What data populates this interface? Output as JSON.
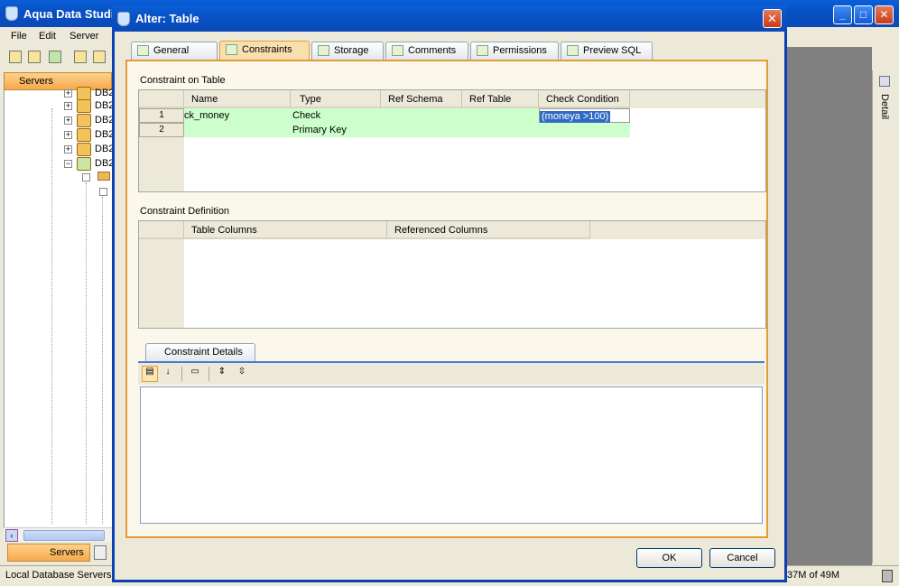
{
  "main_window": {
    "title": "Aqua Data Studi",
    "controls": {
      "minimize": "_",
      "maximize": "□",
      "close": "✕"
    }
  },
  "menu": {
    "file": "File",
    "edit": "Edit",
    "server": "Server"
  },
  "servers_panel": {
    "header": "Servers",
    "tree": [
      {
        "label": "DB2"
      },
      {
        "label": "DB2"
      },
      {
        "label": "DB2"
      },
      {
        "label": "DB2"
      },
      {
        "label": "DB2"
      },
      {
        "label": "DB2"
      }
    ],
    "bottom_tab": "Servers"
  },
  "detail_panel": {
    "label": "Detail"
  },
  "status": {
    "left": "Local Database Servers",
    "memory": "37M of 49M"
  },
  "dialog": {
    "title": "Alter: Table",
    "close": "✕",
    "tabs": [
      {
        "label": "General"
      },
      {
        "label": "Constraints"
      },
      {
        "label": "Storage"
      },
      {
        "label": "Comments"
      },
      {
        "label": "Permissions"
      },
      {
        "label": "Preview SQL"
      }
    ],
    "active_tab": "Constraints",
    "constraints_section": {
      "label": "Constraint on Table",
      "columns": [
        "Name",
        "Type",
        "Ref Schema",
        "Ref Table",
        "Check Condition"
      ],
      "rows": [
        {
          "num": "1",
          "name": "ck_money",
          "type": "Check",
          "ref_schema": "",
          "ref_table": "",
          "check_condition": "(moneya >100)"
        },
        {
          "num": "2",
          "name": "",
          "type": "Primary Key",
          "ref_schema": "",
          "ref_table": "",
          "check_condition": ""
        }
      ]
    },
    "definition_section": {
      "label": "Constraint Definition",
      "columns": [
        "Table Columns",
        "Referenced Columns"
      ]
    },
    "details_section": {
      "tab_label": "Constraint Details"
    },
    "buttons": {
      "ok": "OK",
      "cancel": "Cancel"
    }
  }
}
